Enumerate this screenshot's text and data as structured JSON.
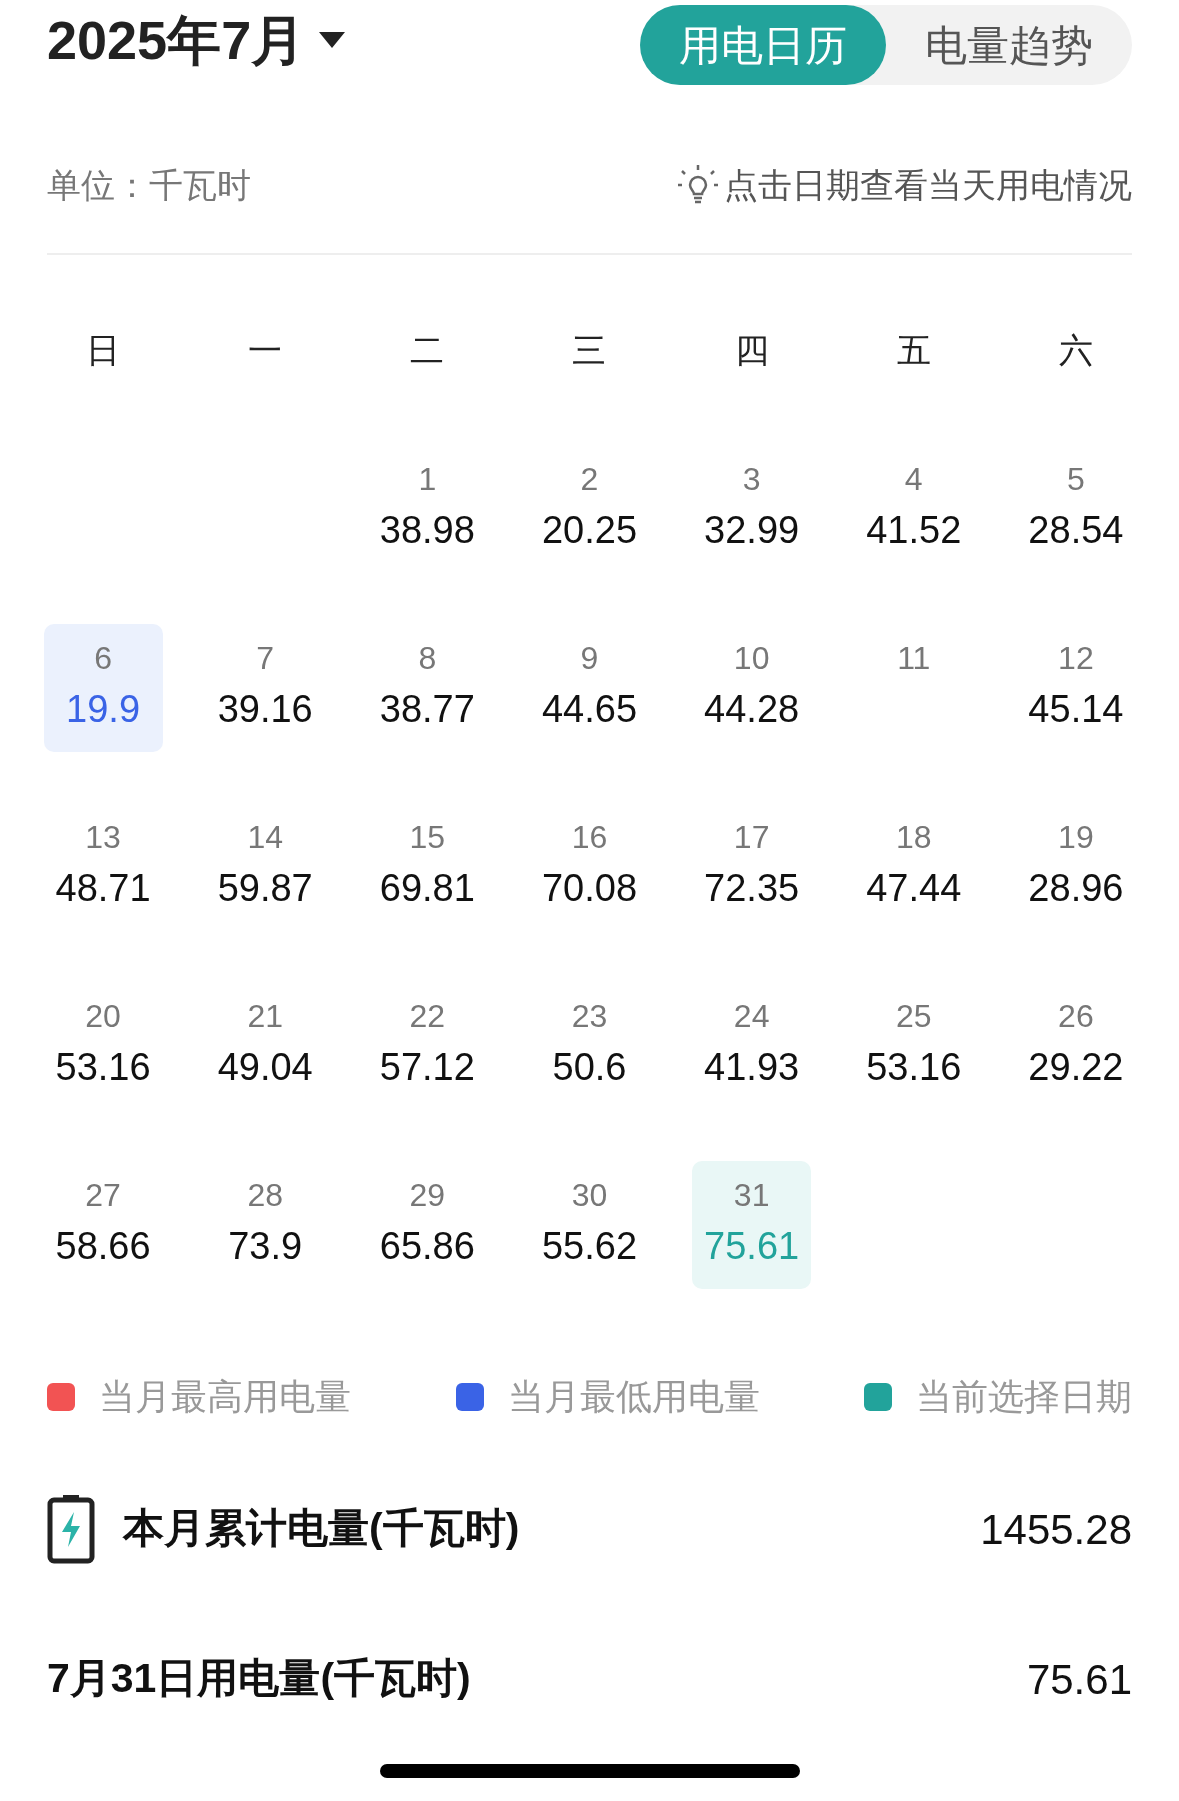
{
  "header": {
    "month": "2025年7月"
  },
  "view_tabs": [
    {
      "label": "用电日历",
      "selected": true
    },
    {
      "label": "电量趋势",
      "selected": false
    }
  ],
  "unit": "单位：千瓦时",
  "hint": "点击日期查看当天用电情况",
  "weekdays": [
    "日",
    "一",
    "二",
    "三",
    "四",
    "五",
    "六"
  ],
  "weeks": [
    [
      {
        "kind": "empty"
      },
      {
        "kind": "empty"
      },
      {
        "kind": "day",
        "day": "1",
        "value": "38.98",
        "lowest": false,
        "selected": false
      },
      {
        "kind": "day",
        "day": "2",
        "value": "20.25",
        "lowest": false,
        "selected": false
      },
      {
        "kind": "day",
        "day": "3",
        "value": "32.99",
        "lowest": false,
        "selected": false
      },
      {
        "kind": "day",
        "day": "4",
        "value": "41.52",
        "lowest": false,
        "selected": false
      },
      {
        "kind": "day",
        "day": "5",
        "value": "28.54",
        "lowest": false,
        "selected": false
      }
    ],
    [
      {
        "kind": "day",
        "day": "6",
        "value": "19.9",
        "lowest": true,
        "selected": false
      },
      {
        "kind": "day",
        "day": "7",
        "value": "39.16",
        "lowest": false,
        "selected": false
      },
      {
        "kind": "day",
        "day": "8",
        "value": "38.77",
        "lowest": false,
        "selected": false
      },
      {
        "kind": "day",
        "day": "9",
        "value": "44.65",
        "lowest": false,
        "selected": false
      },
      {
        "kind": "day",
        "day": "10",
        "value": "44.28",
        "lowest": false,
        "selected": false
      },
      {
        "kind": "day",
        "day": "11",
        "lowest": false,
        "selected": false
      },
      {
        "kind": "day",
        "day": "12",
        "value": "45.14",
        "lowest": false,
        "selected": false
      }
    ],
    [
      {
        "kind": "day",
        "day": "13",
        "value": "48.71",
        "lowest": false,
        "selected": false
      },
      {
        "kind": "day",
        "day": "14",
        "value": "59.87",
        "lowest": false,
        "selected": false
      },
      {
        "kind": "day",
        "day": "15",
        "value": "69.81",
        "lowest": false,
        "selected": false
      },
      {
        "kind": "day",
        "day": "16",
        "value": "70.08",
        "lowest": false,
        "selected": false
      },
      {
        "kind": "day",
        "day": "17",
        "value": "72.35",
        "lowest": false,
        "selected": false
      },
      {
        "kind": "day",
        "day": "18",
        "value": "47.44",
        "lowest": false,
        "selected": false
      },
      {
        "kind": "day",
        "day": "19",
        "value": "28.96",
        "lowest": false,
        "selected": false
      }
    ],
    [
      {
        "kind": "day",
        "day": "20",
        "value": "53.16",
        "lowest": false,
        "selected": false
      },
      {
        "kind": "day",
        "day": "21",
        "value": "49.04",
        "lowest": false,
        "selected": false
      },
      {
        "kind": "day",
        "day": "22",
        "value": "57.12",
        "lowest": false,
        "selected": false
      },
      {
        "kind": "day",
        "day": "23",
        "value": "50.6",
        "lowest": false,
        "selected": false
      },
      {
        "kind": "day",
        "day": "24",
        "value": "41.93",
        "lowest": false,
        "selected": false
      },
      {
        "kind": "day",
        "day": "25",
        "value": "53.16",
        "lowest": false,
        "selected": false
      },
      {
        "kind": "day",
        "day": "26",
        "value": "29.22",
        "lowest": false,
        "selected": false
      }
    ],
    [
      {
        "kind": "day",
        "day": "27",
        "value": "58.66",
        "lowest": false,
        "selected": false
      },
      {
        "kind": "day",
        "day": "28",
        "value": "73.9",
        "lowest": false,
        "selected": false
      },
      {
        "kind": "day",
        "day": "29",
        "value": "65.86",
        "lowest": false,
        "selected": false
      },
      {
        "kind": "day",
        "day": "30",
        "value": "55.62",
        "lowest": false,
        "selected": false
      },
      {
        "kind": "day",
        "day": "31",
        "value": "75.61",
        "lowest": false,
        "selected": true
      }
    ]
  ],
  "legend": [
    {
      "label": "当月最高用电量",
      "color": "#f25353"
    },
    {
      "label": "当月最低用电量",
      "color": "#3a63e6"
    },
    {
      "label": "当前选择日期",
      "color": "#22a39b"
    }
  ],
  "summary": [
    {
      "kind": "total",
      "label": "本月累计电量(千瓦时)",
      "value": "1455.28"
    },
    {
      "kind": "day",
      "label": "7月31日用电量(千瓦时)",
      "value": "75.61"
    }
  ]
}
